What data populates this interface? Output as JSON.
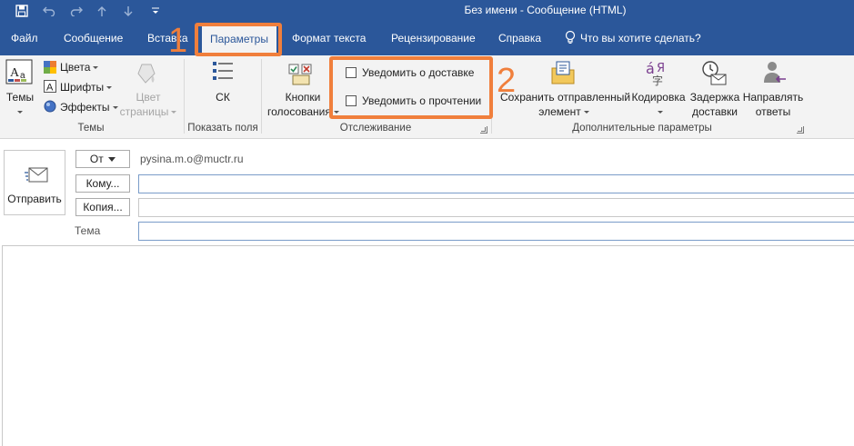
{
  "window": {
    "title": "Без имени  -  Сообщение (HTML)"
  },
  "tabs": [
    {
      "label": "Файл"
    },
    {
      "label": "Сообщение"
    },
    {
      "label": "Вставка"
    },
    {
      "label": "Параметры"
    },
    {
      "label": "Формат текста"
    },
    {
      "label": "Рецензирование"
    },
    {
      "label": "Справка"
    }
  ],
  "tell_me": "Что вы хотите сделать?",
  "ribbon": {
    "themes_group": {
      "label": "Темы",
      "themes_button": "Темы",
      "colors": "Цвета",
      "fonts": "Шрифты",
      "effects": "Эффекты",
      "page_color_line1": "Цвет",
      "page_color_line2": "страницы"
    },
    "show_fields_group": {
      "label": "Показать поля",
      "bcc_button": "СК"
    },
    "tracking_group": {
      "label": "Отслеживание",
      "voting_line1": "Кнопки",
      "voting_line2": "голосования",
      "request_delivery": "Уведомить о доставке",
      "request_read": "Уведомить о прочтении"
    },
    "more_options_group": {
      "label": "Дополнительные параметры",
      "save_sent_line1": "Сохранить отправленный",
      "save_sent_line2": "элемент",
      "encoding": "Кодировка",
      "delay_line1": "Задержка",
      "delay_line2": "доставки",
      "direct_line1": "Направлять",
      "direct_line2": "ответы"
    }
  },
  "annotations": {
    "step1": "1",
    "step2": "2",
    "color": "#f07f3c"
  },
  "compose": {
    "send": "Отправить",
    "from_button": "От",
    "from_address": "pysina.m.o@muctr.ru",
    "to_button": "Кому...",
    "cc_button": "Копия...",
    "subject_label": "Тема",
    "to_value": "",
    "cc_value": "",
    "subject_value": "",
    "body_value": ""
  },
  "colors": {
    "titlebar": "#2b579a",
    "ribbon_bg": "#f3f3f3",
    "accent": "#2b579a"
  }
}
